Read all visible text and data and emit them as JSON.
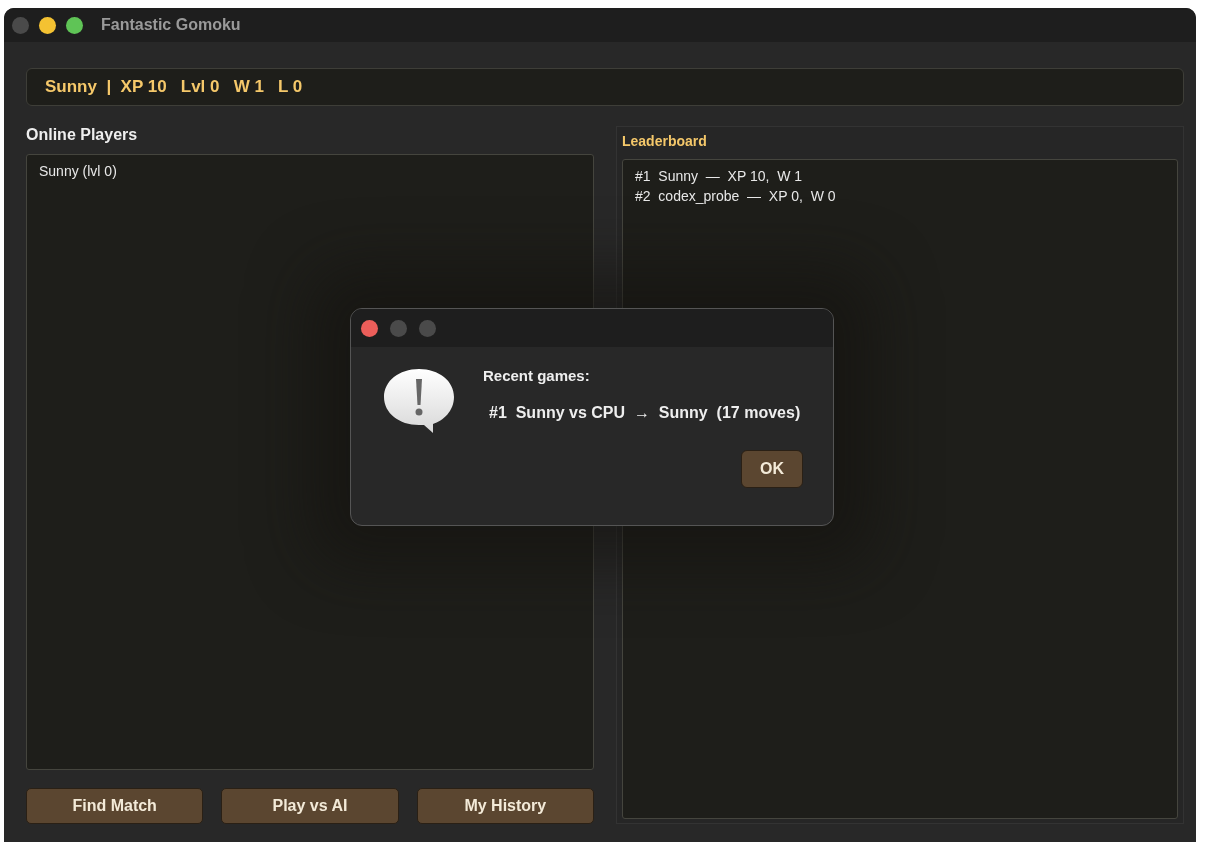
{
  "window": {
    "title": "Fantastic Gomoku"
  },
  "status": "Sunny  |  XP 10   Lvl 0   W 1   L 0",
  "online_players": {
    "title": "Online Players",
    "items": [
      "Sunny (lvl 0)"
    ]
  },
  "buttons": [
    "Find Match",
    "Play vs AI",
    "My History"
  ],
  "leaderboard": {
    "title": "Leaderboard",
    "rows": [
      "#1  Sunny  —  XP 10,  W 1",
      "#2  codex_probe  —  XP 0,  W 0"
    ]
  },
  "dialog": {
    "heading": "Recent games:",
    "lines": [
      "#1  Sunny vs CPU  →  Sunny  (17 moves)"
    ],
    "button": "OK"
  }
}
